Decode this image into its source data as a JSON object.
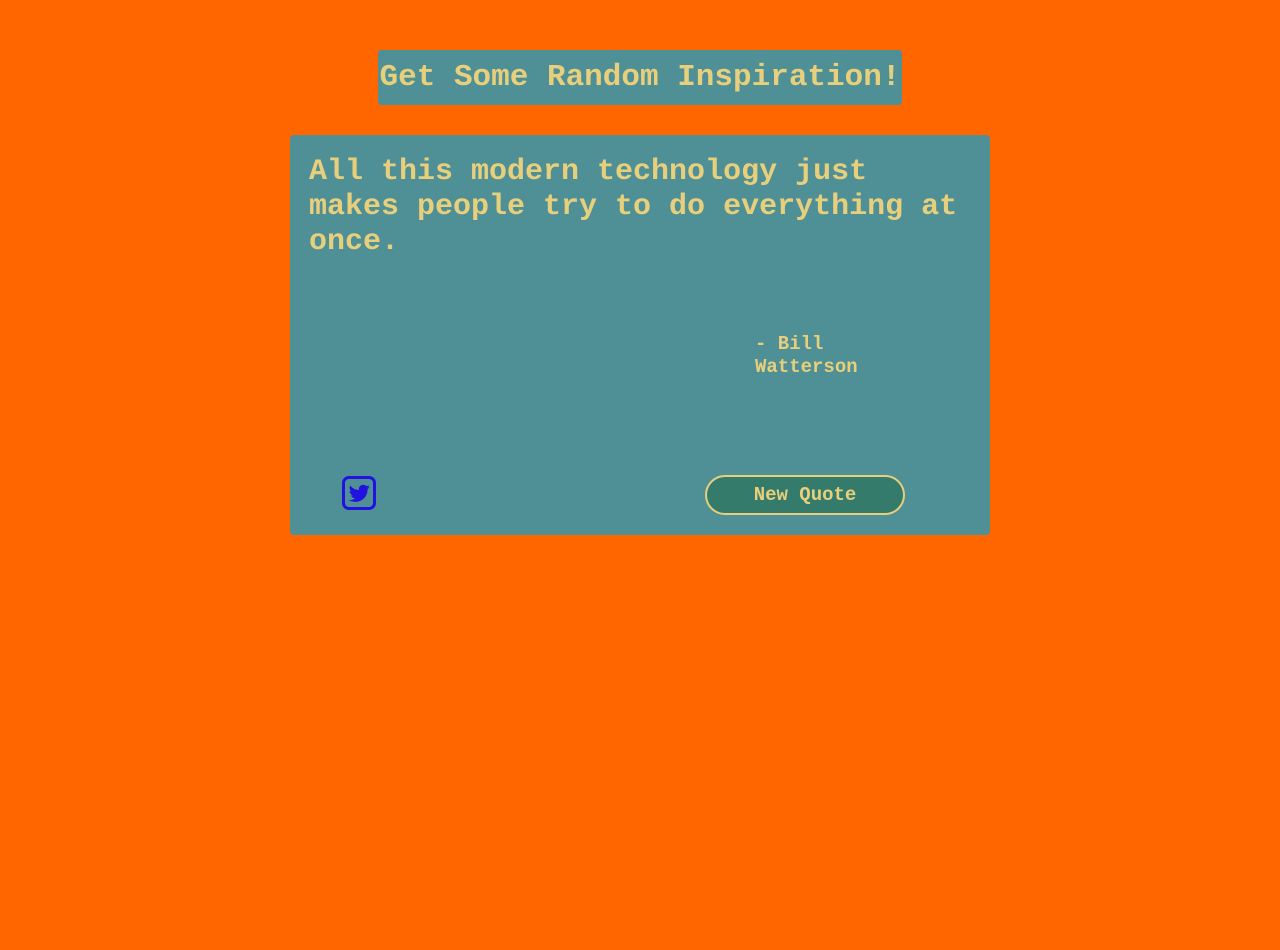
{
  "header": {
    "title": "Get Some Random Inspiration!"
  },
  "quote_box": {
    "text": "All this modern technology just makes people try to do everything at once.",
    "author": "- Bill Watterson",
    "tweet_icon": "twitter-icon",
    "new_quote_label": "New Quote"
  },
  "colors": {
    "page_background": "#ff6600",
    "panel_background": "#4f9096",
    "text": "#e8cf7c",
    "button_background": "#357b6b",
    "tweet_icon": "#2211e0"
  }
}
